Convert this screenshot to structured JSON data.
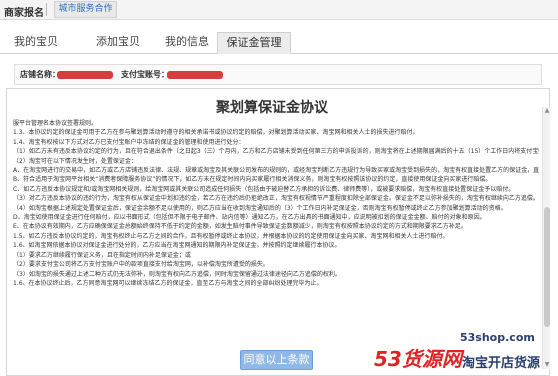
{
  "topbar": {
    "merchant_label": "商家报名",
    "service_link": "城市服务合作"
  },
  "nav": {
    "tabs": [
      "我的宝贝",
      "添加宝贝",
      "我的信息",
      "保证金管理"
    ],
    "active_index": 3
  },
  "store": {
    "name_label": "店铺名称：",
    "alipay_label": "支付宝账号："
  },
  "document": {
    "title": "聚划算保证金协议",
    "paragraphs": [
      "服平台管理名本协议签署规则。",
      "1.3、本协议约定的保证金可用于乙方在参与聚划算活动时遵守的相关承诺书或协议约定的赔偿，对聚划算活动买家、淘宝网和相关人士的损失进行赔付。",
      "1.4、淘宝有权按以下方式对乙方已支付宝账户中冻结的保证金的管理和使用进行处分：",
      "（1）如乙方未有违反本协议约定的行为，且在符合退出条件（之日起3（三）个月内，乙方和乙方店铺未受到任何第三方的申诉投诉的，则淘宝将在上述期限届满后的十五（15）个工作日内将支付宝账户中冻结的保证金予以解冻，解冻后保证金的使用和处分权归乙方所有。",
      "（2）淘宝可在以下情况发生时，处置保证金：",
      "A、在淘宝网进行的交易中，如乙方或乙方店铺违反法律、法规、规章或淘宝及其关联公司发布的规则的，或经淘宝判断乙方违规行为导致买家或淘宝受到损失的，淘宝有权直接处置乙方的保证金，直接使用保证金向买家进行赔付。",
      "B、符合适用于淘宝网平台相关“消费者保障服务协议”的情况下，如乙方未在规定时间内向买家履行相关消保义务，则淘宝有权按照该协议的约定，直接使用保证金向买家进行赔偿。",
      "C、如乙方违反本协议规定和/或淘宝网相关规则，给淘宝网或其关联公司造成任何损失（包括由于被迫替乙方承担的诉讼费、律师费等），或被要求赔偿，淘宝有权直接处置保证金予以赔付。",
      "（3）对乙方违反本协议的违约行为，淘宝有权从保证金中划扣违约金，若乙方在违约后仍拒绝改正，淘宝有权视情节严重程度扣除全部保证金。保证金不足以弥补损失的，淘宝有权继续向乙方追偿。",
      "（4）如淘宝根据上述规定处置保证金后，保证金余额不足以使用的，则乙方应当在收到淘宝通知后的（3）个工作日内补足保证金，否则淘宝有权暂停或终止乙方参加聚划算活动的资格。",
      "D、淘宝如使用保证金进行任何赔付，应以书面形式（包括但不限于电子邮件、站内信等）通知乙方，在乙方出具的书面通知中，应说明被扣划的保证金金额、赔付的对象和原因。",
      "E、在本协议有效期内，乙方应确保保证金总额始终保持不低于约定的金额，如发生赔付事件导致保证金数额减少，则淘宝有权按照本协议约定的方式和期限要求乙方补足。",
      "1.5、如乙方违反本协议约定的，淘宝有权终止与乙方之间的合作，且有权暂停或终止本协议，并根据本协议的约定使用保证金向买家、淘宝网和相关人士进行赔付。",
      "1.6、如淘宝网依据本协议对保证金进行处分的，乙方应当在淘宝网通知的期限内补足保证金，并按照约定继续履行本协议。",
      "（1）要求乙方继续履行保证义务，且在指定时间内补足保证金；或",
      "（2）要求支付宝公司将乙方支付宝账户中的款项直接支付给淘宝网，以补偿淘宝所遭受的损失。",
      "（3）如淘宝的损失通过上述二种方式仍无法弥补，则淘宝有权向乙方追偿，同时淘宝保留通过法律途径向乙方追偿的权利。",
      "1.6、在本协议终止后，乙方同意淘宝网可以继续冻结乙方的保证金，直至乙方与淘宝之间的全部纠纷处理完毕为止。"
    ]
  },
  "agree_button": "同意以上条款",
  "watermark": {
    "site": "53shop.com",
    "brand": "53货源网",
    "slogan": "淘宝开店货源"
  },
  "colors": {
    "accent": "#2d6db4",
    "mask_red": "#d93c3c",
    "agree_bg": "#8fb8e6",
    "brand_red": "#e02424"
  }
}
